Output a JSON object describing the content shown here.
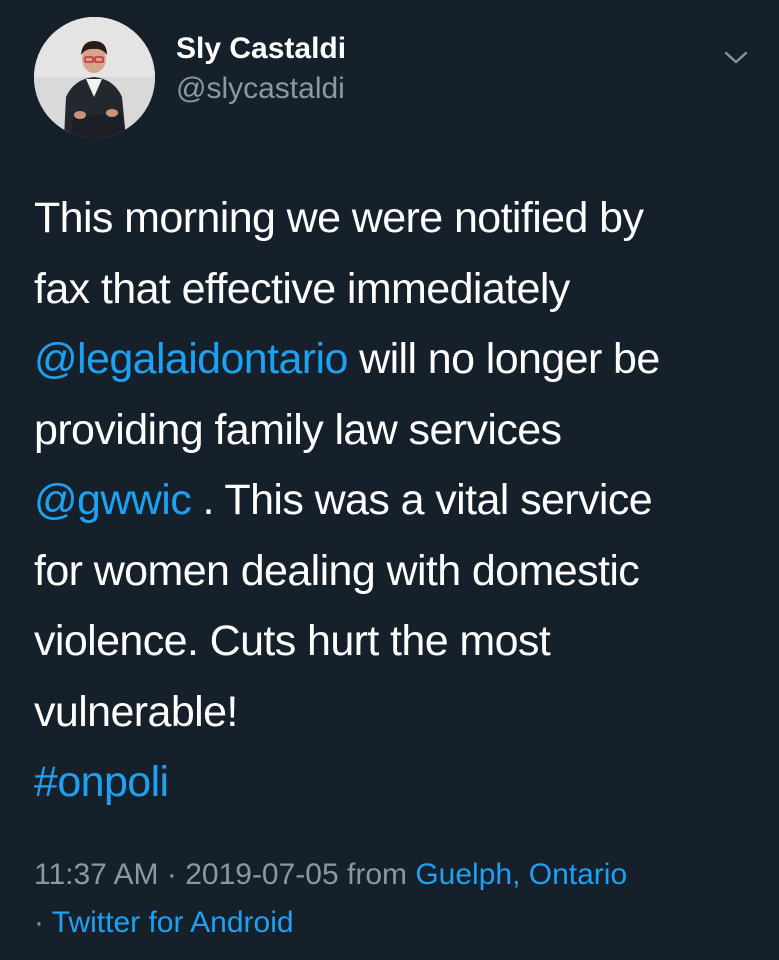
{
  "author": {
    "display_name": "Sly Castaldi",
    "handle": "@slycastaldi"
  },
  "icons": {
    "menu": "chevron-down-icon",
    "avatar": "profile-photo"
  },
  "tweet": {
    "line1": "This morning we were notified by",
    "line2": "fax that effective immediately",
    "mention1": "@legalaidontario",
    "line3_rest": " will no longer be",
    "line4": "providing family law services",
    "mention2": "@gwwic",
    "line5_rest": " . This was a vital service",
    "line6": "for women dealing with domestic",
    "line7": "violence.  Cuts hurt the most",
    "line8": "vulnerable!",
    "hashtag": "#onpoli"
  },
  "meta": {
    "time": "11:37 AM",
    "sep1": " · ",
    "date": "2019-07-05",
    "from_label": " from ",
    "location": "Guelph, Ontario",
    "sep2": "· ",
    "source": "Twitter for Android"
  },
  "colors": {
    "background": "#15202b",
    "text": "#ffffff",
    "secondary": "#8899a6",
    "link": "#1da1f2"
  }
}
